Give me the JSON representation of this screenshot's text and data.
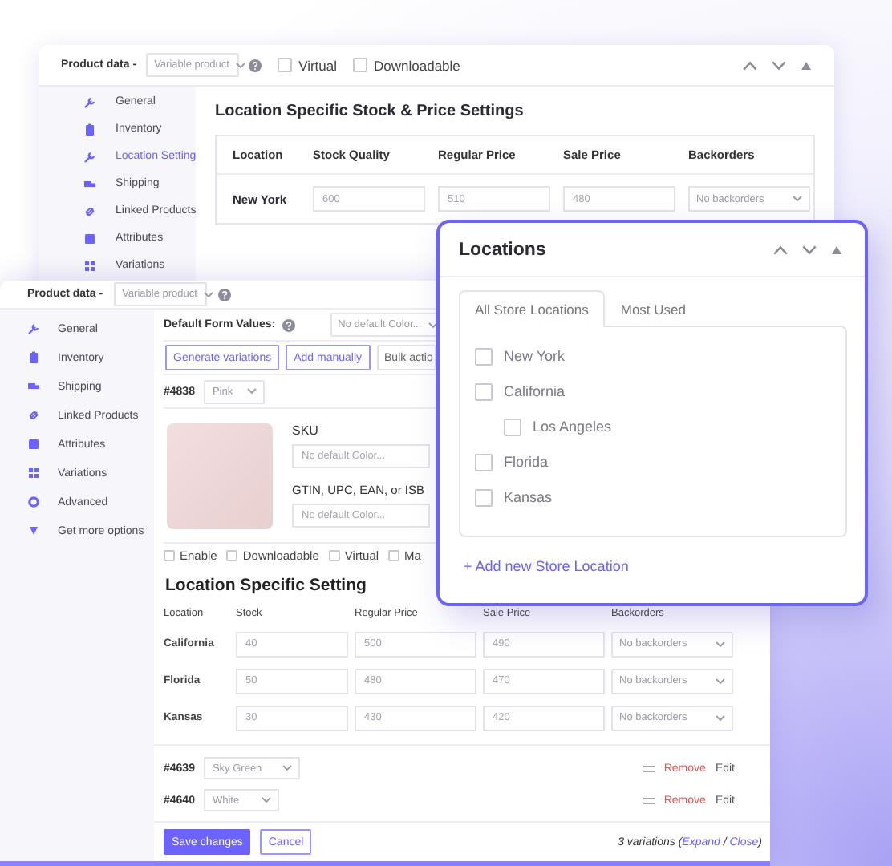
{
  "back_window": {
    "header": {
      "label": "Product data -",
      "product_type": "Variable product",
      "checkboxes": [
        {
          "label": "Virtual",
          "checked": false
        },
        {
          "label": "Downloadable",
          "checked": false
        }
      ]
    },
    "sidebar": [
      {
        "label": "General",
        "selected": false
      },
      {
        "label": "Inventory",
        "selected": false
      },
      {
        "label": "Location Setting",
        "selected": true
      },
      {
        "label": "Shipping",
        "selected": false
      },
      {
        "label": "Linked Products",
        "selected": false
      },
      {
        "label": "Attributes",
        "selected": false
      },
      {
        "label": "Variations",
        "selected": false
      }
    ],
    "section_title": "Location Specific Stock & Price Settings",
    "table": {
      "columns": [
        "Location",
        "Stock Quality",
        "Regular Price",
        "Sale Price",
        "Backorders"
      ],
      "rows": [
        {
          "location": "New York",
          "stock": "600",
          "regular_price": "510",
          "sale_price": "480",
          "backorders": "No backorders"
        }
      ]
    }
  },
  "front_window": {
    "header": {
      "label": "Product data -",
      "product_type": "Variable product"
    },
    "sidebar": [
      {
        "label": "General",
        "selected": false
      },
      {
        "label": "Inventory",
        "selected": false
      },
      {
        "label": "Shipping",
        "selected": false
      },
      {
        "label": "Linked Products",
        "selected": false
      },
      {
        "label": "Attributes",
        "selected": false
      },
      {
        "label": "Variations",
        "selected": false
      },
      {
        "label": "Advanced",
        "selected": false
      },
      {
        "label": "Get more options",
        "selected": false
      }
    ],
    "default_form_values": {
      "label": "Default Form Values:",
      "value": "No default Color..."
    },
    "actions": [
      {
        "label": "Generate variations",
        "kind": "outline"
      },
      {
        "label": "Add manually",
        "kind": "outline"
      },
      {
        "label": "Bulk actio",
        "kind": "plain"
      }
    ],
    "variation": {
      "id": "#4838",
      "attribute_value": "Pink",
      "sku_label": "SKU",
      "sku_placeholder": "No default Color...",
      "gtin_label": "GTIN, UPC, EAN, or ISB",
      "gtin_placeholder": "No default Color...",
      "options": [
        {
          "label": "Enable",
          "checked": false
        },
        {
          "label": "Downloadable",
          "checked": false
        },
        {
          "label": "Virtual",
          "checked": false
        },
        {
          "label": "Ma",
          "checked": false
        }
      ]
    },
    "location_title": "Location Specific Setting",
    "table": {
      "columns": [
        "Location",
        "Stock",
        "Regular Price",
        "Sale Price",
        "Backorders"
      ],
      "rows": [
        {
          "location": "California",
          "stock": "40",
          "regular_price": "500",
          "sale_price": "490",
          "backorders": "No backorders"
        },
        {
          "location": "Florida",
          "stock": "50",
          "regular_price": "480",
          "sale_price": "470",
          "backorders": "No backorders"
        },
        {
          "location": "Kansas",
          "stock": "30",
          "regular_price": "430",
          "sale_price": "420",
          "backorders": "No backorders"
        }
      ]
    },
    "other_variations": [
      {
        "id": "#4639",
        "attribute_value": "Sky Green",
        "remove": "Remove",
        "edit": "Edit"
      },
      {
        "id": "#4640",
        "attribute_value": "White",
        "remove": "Remove",
        "edit": "Edit"
      }
    ],
    "footer": {
      "save": "Save changes",
      "cancel": "Cancel",
      "summary_prefix": "3 variations (",
      "expand": "Expand",
      "separator": " / ",
      "close": "Close",
      "summary_suffix": ")"
    }
  },
  "locations_panel": {
    "title": "Locations",
    "tabs": [
      {
        "label": "All Store Locations",
        "selected": true
      },
      {
        "label": "Most Used",
        "selected": false
      }
    ],
    "locations": [
      {
        "label": "New York",
        "checked": false
      },
      {
        "label": "California",
        "checked": false,
        "children": [
          {
            "label": "Los Angeles",
            "checked": false
          }
        ]
      },
      {
        "label": "Florida",
        "checked": false
      },
      {
        "label": "Kansas",
        "checked": false
      }
    ],
    "add_link": "+ Add new Store Location"
  }
}
